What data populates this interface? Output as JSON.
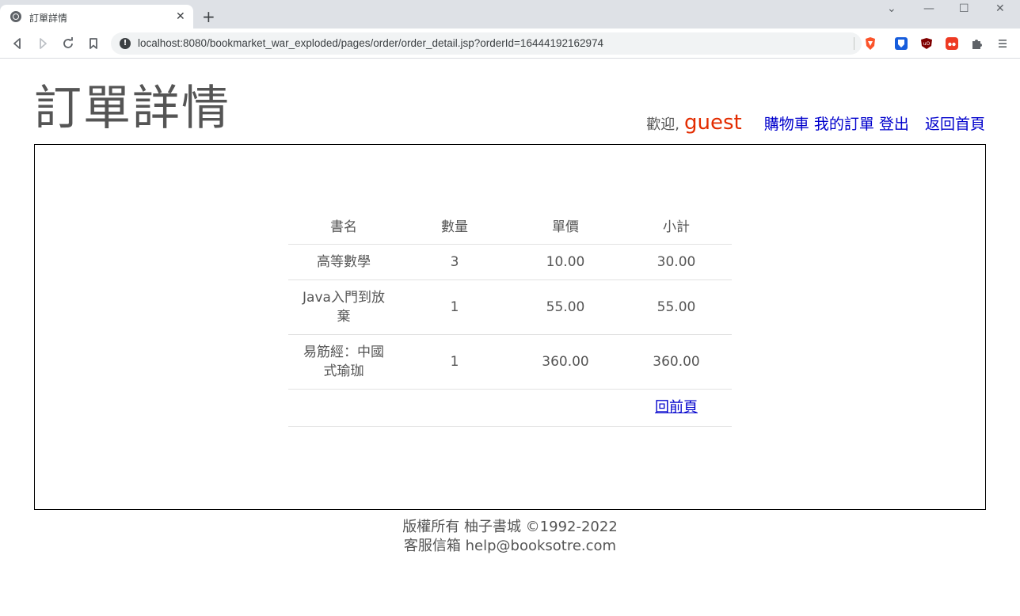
{
  "browser": {
    "tab_title": "訂單詳情",
    "tab_close": "✕",
    "new_tab": "+",
    "url": "localhost:8080/bookmarket_war_exploded/pages/order/order_detail.jsp?orderId=16444192162974",
    "controls": {
      "dropdown": "⌄",
      "minimize": "—",
      "maximize": "☐",
      "close": "✕"
    }
  },
  "header": {
    "title": "訂單詳情",
    "welcome": "歡迎,",
    "username": "guest",
    "links": {
      "cart": "購物車",
      "my_orders": "我的訂單",
      "logout": "登出",
      "home": "返回首頁"
    }
  },
  "order_table": {
    "headers": [
      "書名",
      "數量",
      "單價",
      "小計"
    ],
    "rows": [
      {
        "name": "高等數學",
        "quantity": "3",
        "price": "10.00",
        "subtotal": "30.00"
      },
      {
        "name": "Java入門到放棄",
        "quantity": "1",
        "price": "55.00",
        "subtotal": "55.00"
      },
      {
        "name": "易筋經：中國式瑜珈",
        "quantity": "1",
        "price": "360.00",
        "subtotal": "360.00"
      }
    ],
    "back_link": "回前頁"
  },
  "footer": {
    "copyright": "版權所有 柚子書城 ©1992-2022",
    "email": "客服信箱 help@booksotre.com"
  }
}
